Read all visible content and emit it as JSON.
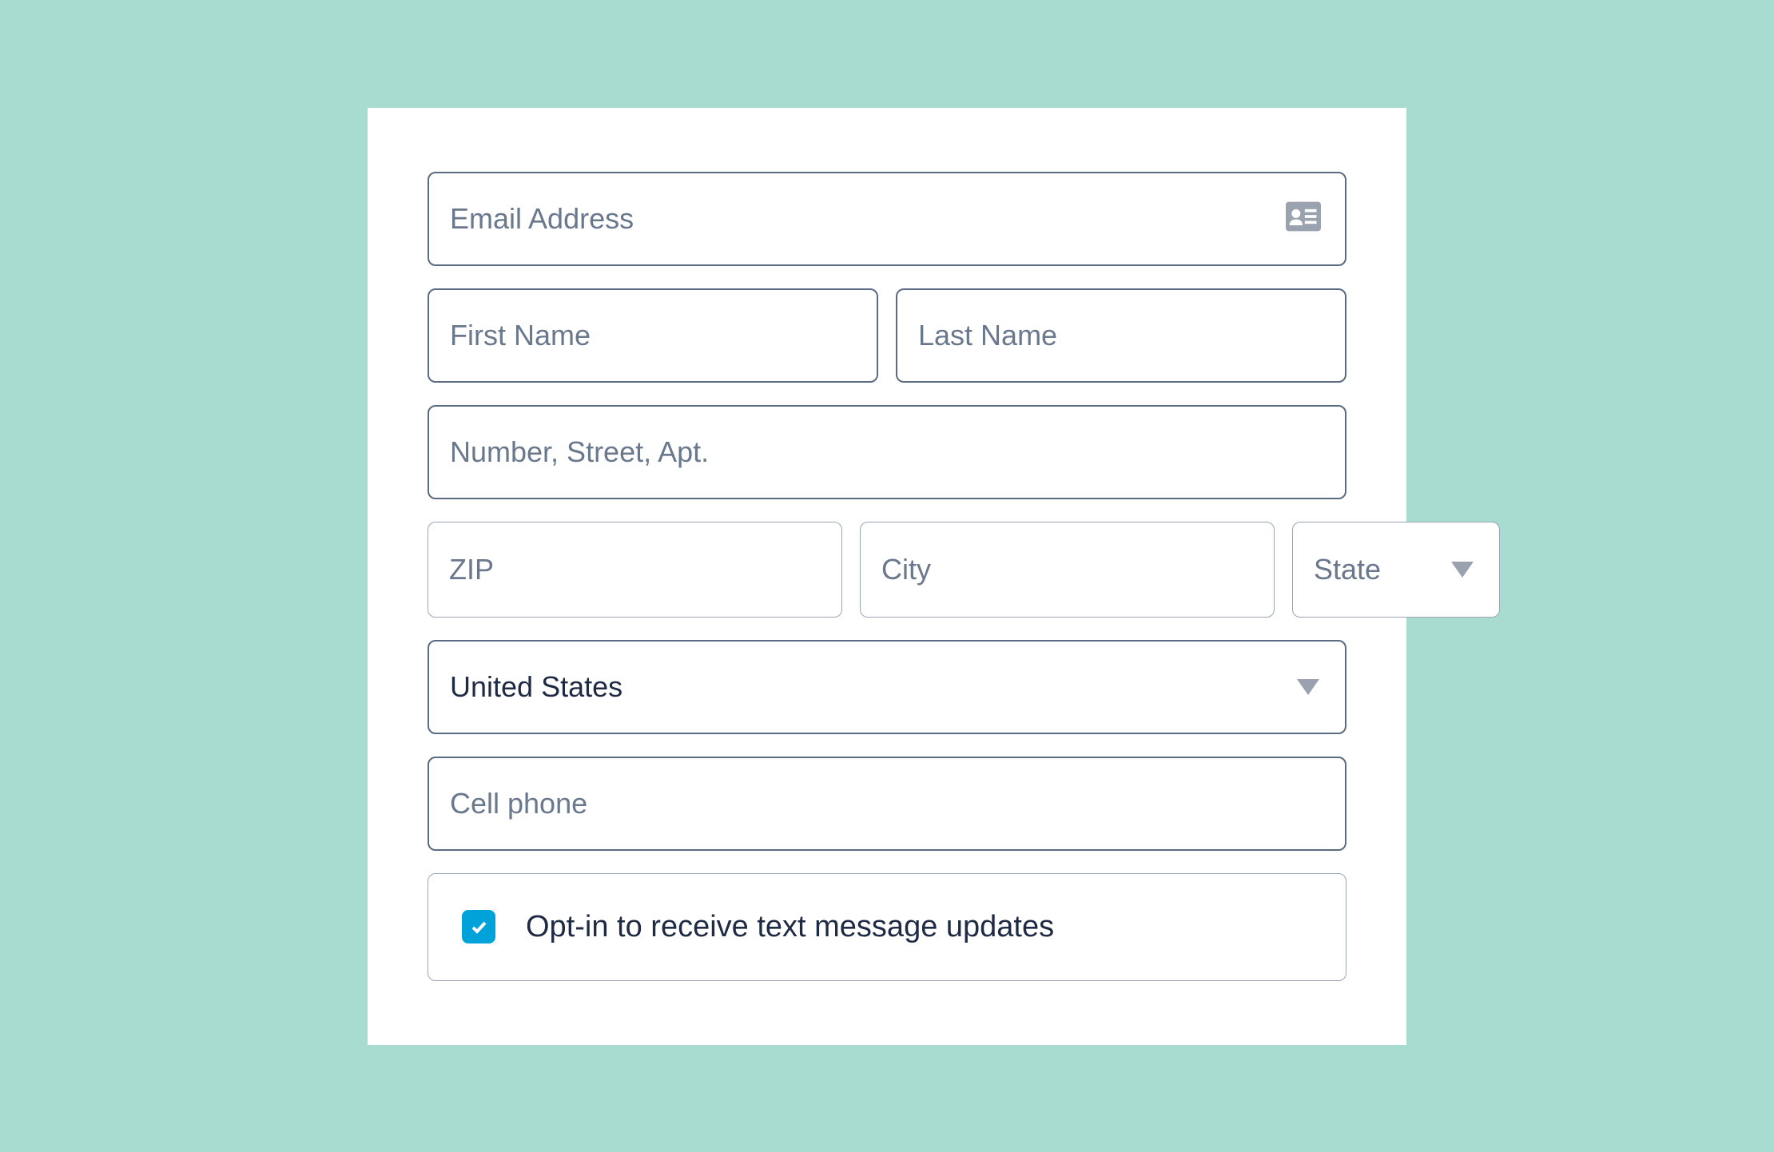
{
  "form": {
    "email": {
      "placeholder": "Email Address",
      "value": ""
    },
    "first_name": {
      "placeholder": "First Name",
      "value": ""
    },
    "last_name": {
      "placeholder": "Last Name",
      "value": ""
    },
    "street": {
      "placeholder": "Number, Street, Apt.",
      "value": ""
    },
    "zip": {
      "placeholder": "ZIP",
      "value": ""
    },
    "city": {
      "placeholder": "City",
      "value": ""
    },
    "state": {
      "placeholder": "State",
      "value": ""
    },
    "country": {
      "value": "United States"
    },
    "phone": {
      "placeholder": "Cell phone",
      "value": ""
    },
    "opt_in": {
      "label": "Opt-in to receive text message updates",
      "checked": true
    }
  }
}
